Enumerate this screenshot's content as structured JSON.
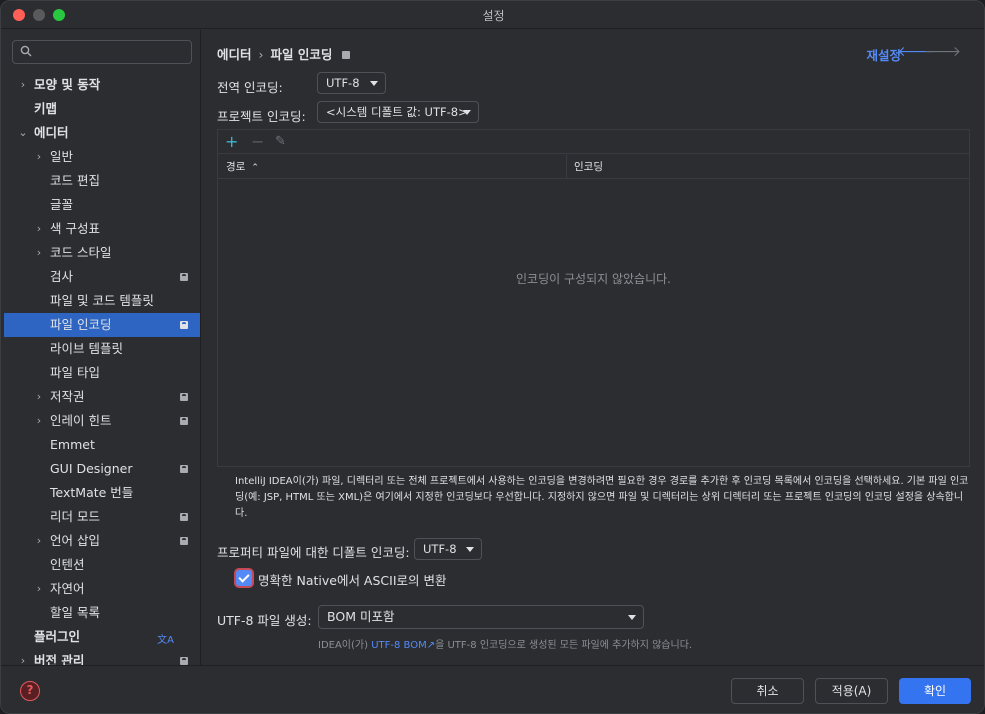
{
  "window": {
    "title": "설정"
  },
  "sidebar": {
    "search_placeholder": "",
    "items": [
      {
        "label": "모양 및 동작",
        "chevron": "›",
        "bold": true
      },
      {
        "label": "키맵",
        "chevron": "",
        "bold": true
      },
      {
        "label": "에디터",
        "chevron": "⌄",
        "bold": true
      },
      {
        "label": "일반",
        "chevron": "›"
      },
      {
        "label": "코드 편집",
        "chevron": ""
      },
      {
        "label": "글꼴",
        "chevron": ""
      },
      {
        "label": "색 구성표",
        "chevron": "›"
      },
      {
        "label": "코드 스타일",
        "chevron": "›"
      },
      {
        "label": "검사",
        "chevron": "",
        "badge": true
      },
      {
        "label": "파일 및 코드 템플릿",
        "chevron": ""
      },
      {
        "label": "파일 인코딩",
        "chevron": "",
        "badge": true,
        "selected": true
      },
      {
        "label": "라이브 템플릿",
        "chevron": ""
      },
      {
        "label": "파일 타입",
        "chevron": ""
      },
      {
        "label": "저작권",
        "chevron": "›",
        "badge": true
      },
      {
        "label": "인레이 힌트",
        "chevron": "›",
        "badge": true
      },
      {
        "label": "Emmet",
        "chevron": ""
      },
      {
        "label": "GUI Designer",
        "chevron": "",
        "badge": true
      },
      {
        "label": "TextMate 번들",
        "chevron": ""
      },
      {
        "label": "리더 모드",
        "chevron": "",
        "badge": true
      },
      {
        "label": "언어 삽입",
        "chevron": "›",
        "badge": true
      },
      {
        "label": "인텐션",
        "chevron": ""
      },
      {
        "label": "자연어",
        "chevron": "›"
      },
      {
        "label": "할일 목록",
        "chevron": ""
      },
      {
        "label": "플러그인",
        "chevron": "",
        "bold": true,
        "translate_icon": true
      },
      {
        "label": "버전 관리",
        "chevron": "›",
        "bold": true,
        "badge": true
      }
    ]
  },
  "header": {
    "breadcrumb": [
      "에디터",
      "파일 인코딩"
    ],
    "separator": "›",
    "reset_label": "재설정",
    "back_icon": "arrow-left-icon",
    "forward_icon": "arrow-right-icon"
  },
  "settings": {
    "global_label": "전역 인코딩:",
    "global_value": "UTF-8",
    "project_label": "프로젝트 인코딩:",
    "project_value": "<시스템 디폴트 값: UTF-8>",
    "table": {
      "columns": [
        "경로",
        "인코딩"
      ],
      "sort_indicator": "⌃",
      "empty_text": "인코딩이 구성되지 않았습니다.",
      "rows": []
    },
    "description": "IntelliJ IDEA이(가) 파일, 디렉터리 또는 전체 프로젝트에서 사용하는 인코딩을 변경하려면 필요한 경우 경로를 추가한 후 인코딩 목록에서 인코딩을 선택하세요. 기본 파일 인코딩(예: JSP, HTML 또는 XML)은 여기에서 지정한 인코딩보다 우선합니다. 지정하지 않으면 파일 및 디렉터리는 상위 디렉터리 또는 프로젝트 인코딩의 인코딩 설정을 상속합니다.",
    "properties_label": "프로퍼티 파일에 대한 디폴트 인코딩:",
    "properties_value": "UTF-8",
    "native_ascii_label": "명확한 Native에서 ASCII로의 변환",
    "native_ascii_checked": true,
    "bom_label": "UTF-8 파일 생성:",
    "bom_value": "BOM 미포함",
    "bom_hint_prefix": "IDEA이(가) ",
    "bom_hint_link": "UTF-8 BOM",
    "bom_hint_suffix": "을 UTF-8 인코딩으로 생성된 모든 파일에 추가하지 않습니다."
  },
  "footer": {
    "help_label": "?",
    "cancel_label": "취소",
    "apply_label": "적용(A)",
    "ok_label": "확인"
  },
  "colors": {
    "accent": "#548af7",
    "selection": "#2e65c3",
    "primary_button": "#3574f0",
    "background": "#2b2d30"
  }
}
